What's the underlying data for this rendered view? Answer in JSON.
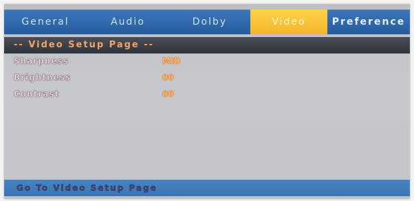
{
  "tabs": [
    {
      "label": "General",
      "active": false
    },
    {
      "label": "Audio",
      "active": false
    },
    {
      "label": "Dolby",
      "active": false
    },
    {
      "label": "Video",
      "active": true
    },
    {
      "label": "Preference",
      "active": false
    }
  ],
  "page": {
    "title": "-- Video Setup Page --"
  },
  "settings": [
    {
      "label": "Sharpness",
      "value": "MID"
    },
    {
      "label": "Brightness",
      "value": "00"
    },
    {
      "label": "Contrast",
      "value": "00"
    }
  ],
  "status": {
    "text": "Go To Video Setup Page"
  },
  "colors": {
    "tab_bar": "#2f68ab",
    "active_tab": "#f4b62a",
    "header_bar": "#2f333a",
    "title_text": "#f2a36b",
    "value_text": "#f6c27a",
    "status_bar": "#3b74b3"
  }
}
